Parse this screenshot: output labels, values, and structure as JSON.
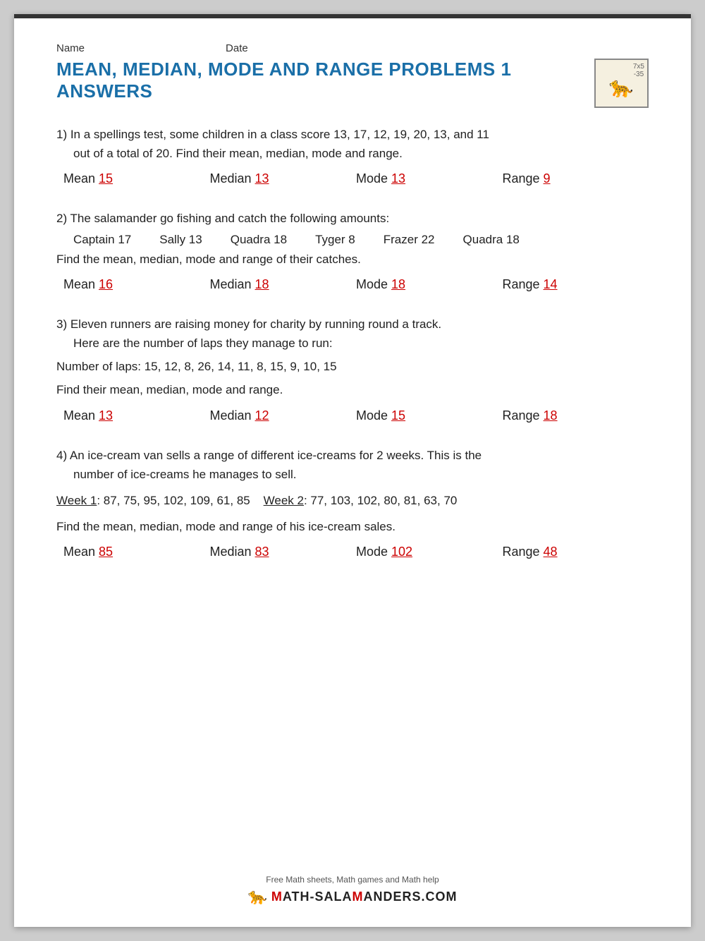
{
  "header": {
    "name_label": "Name",
    "date_label": "Date",
    "title": "MEAN, MEDIAN, MODE AND RANGE PROBLEMS 1 ANSWERS"
  },
  "questions": [
    {
      "number": "1)",
      "text_line1": "In a spellings test, some children in a class score 13, 17, 12, 19, 20, 13, and 11",
      "text_line2": "out of a total of 20. Find their mean, median, mode and range.",
      "answers": [
        {
          "label": "Mean",
          "value": "15"
        },
        {
          "label": "Median",
          "value": "13"
        },
        {
          "label": "Mode",
          "value": "13"
        },
        {
          "label": "Range",
          "value": "9"
        }
      ]
    },
    {
      "number": "2)",
      "text_line1": "The salamander go fishing and catch the following amounts:",
      "captain_row": "Captain 17    Sally 13    Quadra 18    Tyger 8    Frazer 22    Quadra 18",
      "text_line2": "Find the mean, median, mode and range of their catches.",
      "answers": [
        {
          "label": "Mean",
          "value": "16"
        },
        {
          "label": "Median",
          "value": "18"
        },
        {
          "label": "Mode",
          "value": "18"
        },
        {
          "label": "Range",
          "value": "14"
        }
      ]
    },
    {
      "number": "3)",
      "text_line1": "Eleven runners are raising money for charity by running round a track.",
      "text_line2": "Here are the number of laps they manage to run:",
      "text_line3": "Number of laps: 15, 12, 8, 26, 14, 11, 8, 15, 9, 10, 15",
      "text_line4": "Find their mean, median, mode and range.",
      "answers": [
        {
          "label": "Mean",
          "value": "13"
        },
        {
          "label": "Median",
          "value": "12"
        },
        {
          "label": "Mode",
          "value": "15"
        },
        {
          "label": "Range",
          "value": "18"
        }
      ]
    },
    {
      "number": "4)",
      "text_line1": "An ice-cream van sells a range of different ice-creams for 2 weeks. This is the",
      "text_line2": "number of ice-creams he manages to sell.",
      "week_line": "Week 1: 87, 75, 95, 102, 109, 61, 85   Week 2: 77, 103, 102, 80, 81, 63, 70",
      "text_line3": "Find the mean, median, mode and range of his ice-cream sales.",
      "answers": [
        {
          "label": "Mean",
          "value": "85"
        },
        {
          "label": "Median",
          "value": "83"
        },
        {
          "label": "Mode",
          "value": "102"
        },
        {
          "label": "Range",
          "value": "48"
        }
      ]
    }
  ],
  "footer": {
    "tagline": "Free Math sheets, Math games and Math help",
    "site": "MATH-SALAMANDERS.COM"
  }
}
